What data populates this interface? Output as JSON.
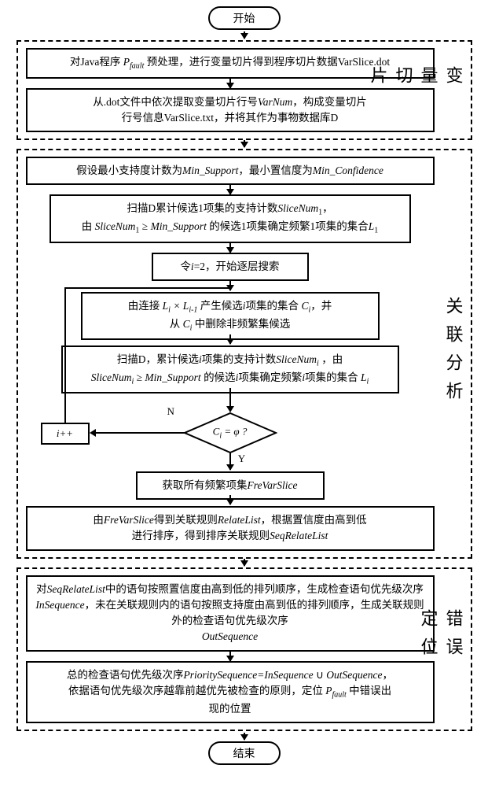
{
  "start": "开始",
  "end": "结束",
  "sections": {
    "s1": {
      "label": "变量切片",
      "box1": "对Java程序 P_fault 预处理，进行变量切片得到程序切片数据VarSlice.dot",
      "box2": "从.dot文件中依次提取变量切片行号VarNum，构成变量切片行号信息VarSlice.txt，并将其作为事物数据库D"
    },
    "s2": {
      "label": "关联分析",
      "box1": "假设最小支持度计数为Min_Support，最小置信度为Min_Confidence",
      "box2": "扫描D累计候选1项集的支持计数SliceNum₁，由 SliceNum₁ ≥ Min_Support 的候选1项集确定频繁1项集的集合L₁",
      "box3": "令i=2，开始逐层搜索",
      "box4": "由连接 Lᵢ × Lᵢ₋₁ 产生候选i项集的集合 Cᵢ，并从 Cᵢ 中删除非频繁集候选",
      "box5": "扫描D，累计候选i项集的支持计数SliceNumᵢ，由 SliceNumᵢ ≥ Min_Support 的候选i项集确定频繁i项集的集合 Lᵢ",
      "diamond": "Cᵢ = φ ?",
      "n": "N",
      "y": "Y",
      "ipp": "i++",
      "box6": "获取所有频繁项集FreVarSlice",
      "box7": "由FreVarSlice得到关联规则RelateList，根据置信度由高到低进行排序，得到排序关联规则SeqRelateList"
    },
    "s3": {
      "label": "错误定位",
      "box1": "对SeqRelateList中的语句按照置信度由高到低的排列顺序，生成检查语句优先级次序InSequence，未在关联规则内的语句按照支持度由高到低的排列顺序，生成关联规则外的检查语句优先级次序OutSequence",
      "box2": "总的检查语句优先级次序PrioritySequence=InSequence ∪ OutSequence，依据语句优先级次序越靠前越优先被检查的原则，定位 P_fault 中错误出现的位置"
    }
  }
}
